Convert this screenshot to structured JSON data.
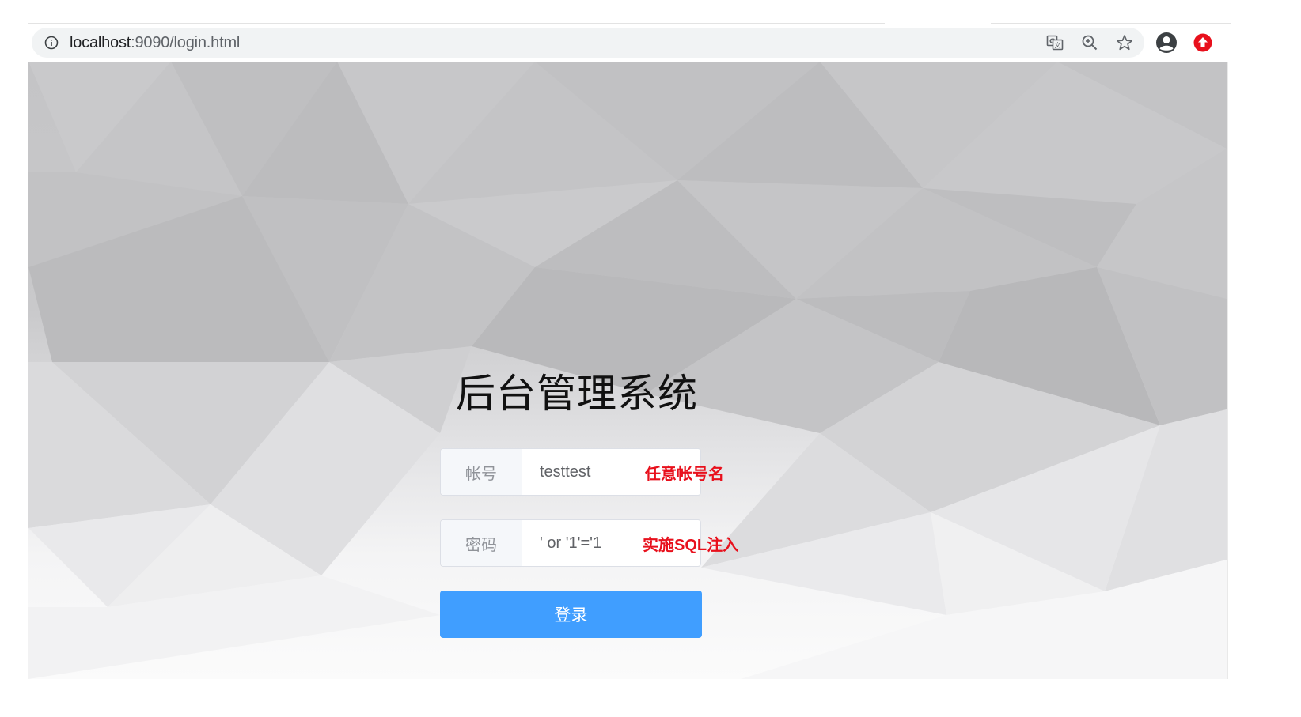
{
  "browser": {
    "url_host": "localhost",
    "url_rest": ":9090/login.html",
    "icons": [
      "info-icon",
      "translate-icon",
      "zoom-icon",
      "star-icon",
      "account-icon",
      "update-icon"
    ],
    "accent_update": "#e8101c"
  },
  "page": {
    "title": "后台管理系统",
    "account_field": {
      "label": "帐号",
      "value": "testtest",
      "annotation": "任意帐号名"
    },
    "password_field": {
      "label": "密码",
      "value": "' or '1'='1",
      "annotation": "实施SQL注入"
    },
    "login_button": "登录",
    "colors": {
      "button": "#409eff",
      "annotation": "#e8101c"
    }
  }
}
